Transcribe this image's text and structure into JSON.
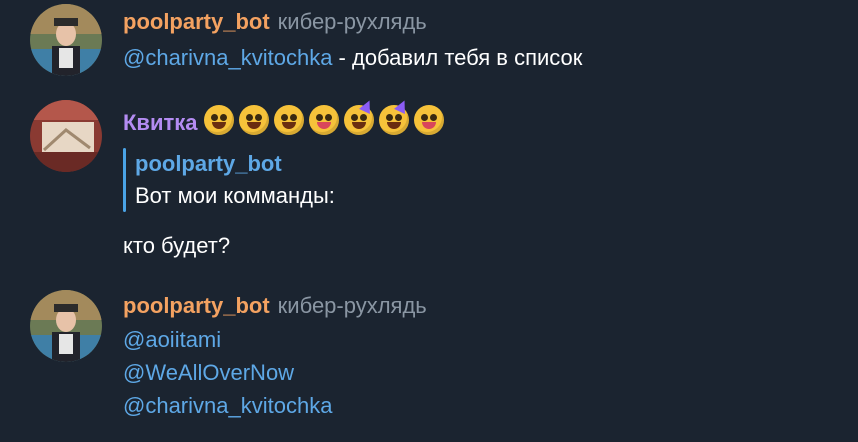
{
  "colors": {
    "background": "#1b2430",
    "bot_name": "#f4a261",
    "user_name": "#b48cf2",
    "mention": "#5ea8e6",
    "tag": "#8a96a3"
  },
  "messages": [
    {
      "sender": "poolparty_bot",
      "tag": "кибер-рухлядь",
      "mention": "@charivna_kvitochka",
      "text": " - добавил тебя в список"
    },
    {
      "sender": "Квитка",
      "reply": {
        "name": "poolparty_bot",
        "text": "Вот мои комманды:"
      },
      "text": "кто будет?"
    },
    {
      "sender": "poolparty_bot",
      "tag": "кибер-рухлядь",
      "mentions": [
        "@aoiitami",
        "@WeAllOverNow",
        "@charivna_kvitochka"
      ]
    }
  ]
}
